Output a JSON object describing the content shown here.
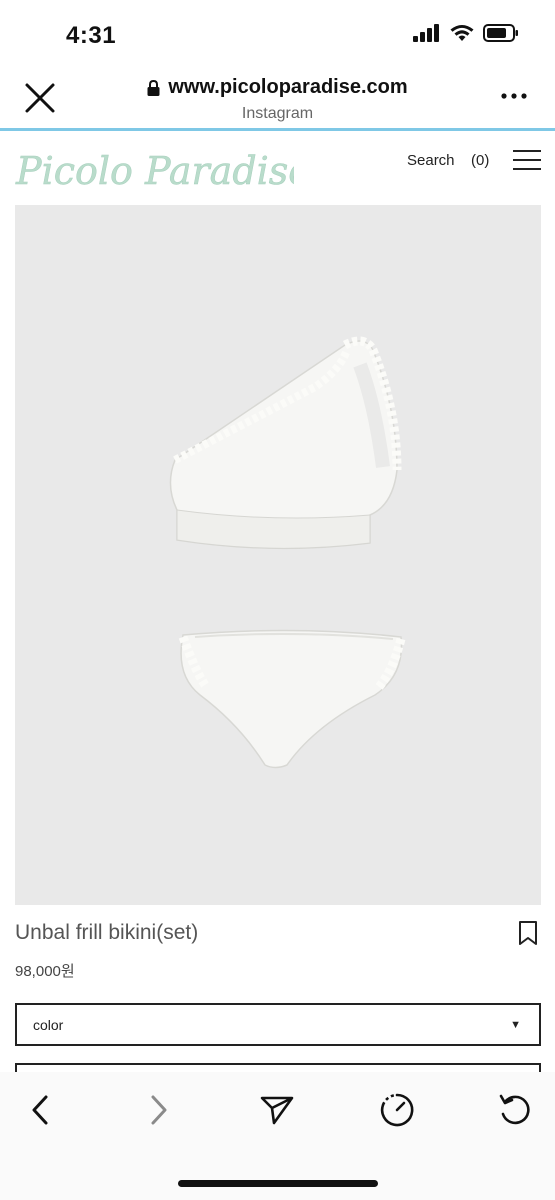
{
  "status_bar": {
    "time": "4:31",
    "icons": [
      "cellular-signal-icon",
      "wifi-icon",
      "battery-icon"
    ]
  },
  "browser": {
    "url": "www.picoloparadise.com",
    "source_app": "Instagram",
    "accent_color": "#7fc8e6",
    "icons": [
      "close-icon",
      "lock-icon",
      "more-icon"
    ]
  },
  "site_header": {
    "logo_text": "Picolo Paradise",
    "search_label": "Search",
    "cart_count": "(0)",
    "logo_color": "#b9dccb",
    "icons": [
      "hamburger-menu-icon"
    ]
  },
  "product": {
    "name": "Unbal frill bikini(set)",
    "price": "98,000원",
    "image_alt": "white one-shoulder frill bikini set",
    "icons": [
      "bookmark-icon"
    ]
  },
  "options": {
    "color_select_label": "color"
  },
  "toolbar": {
    "icons": [
      "back-arrow-icon",
      "forward-arrow-icon",
      "share-send-icon",
      "speed-gauge-icon",
      "reload-icon"
    ]
  }
}
